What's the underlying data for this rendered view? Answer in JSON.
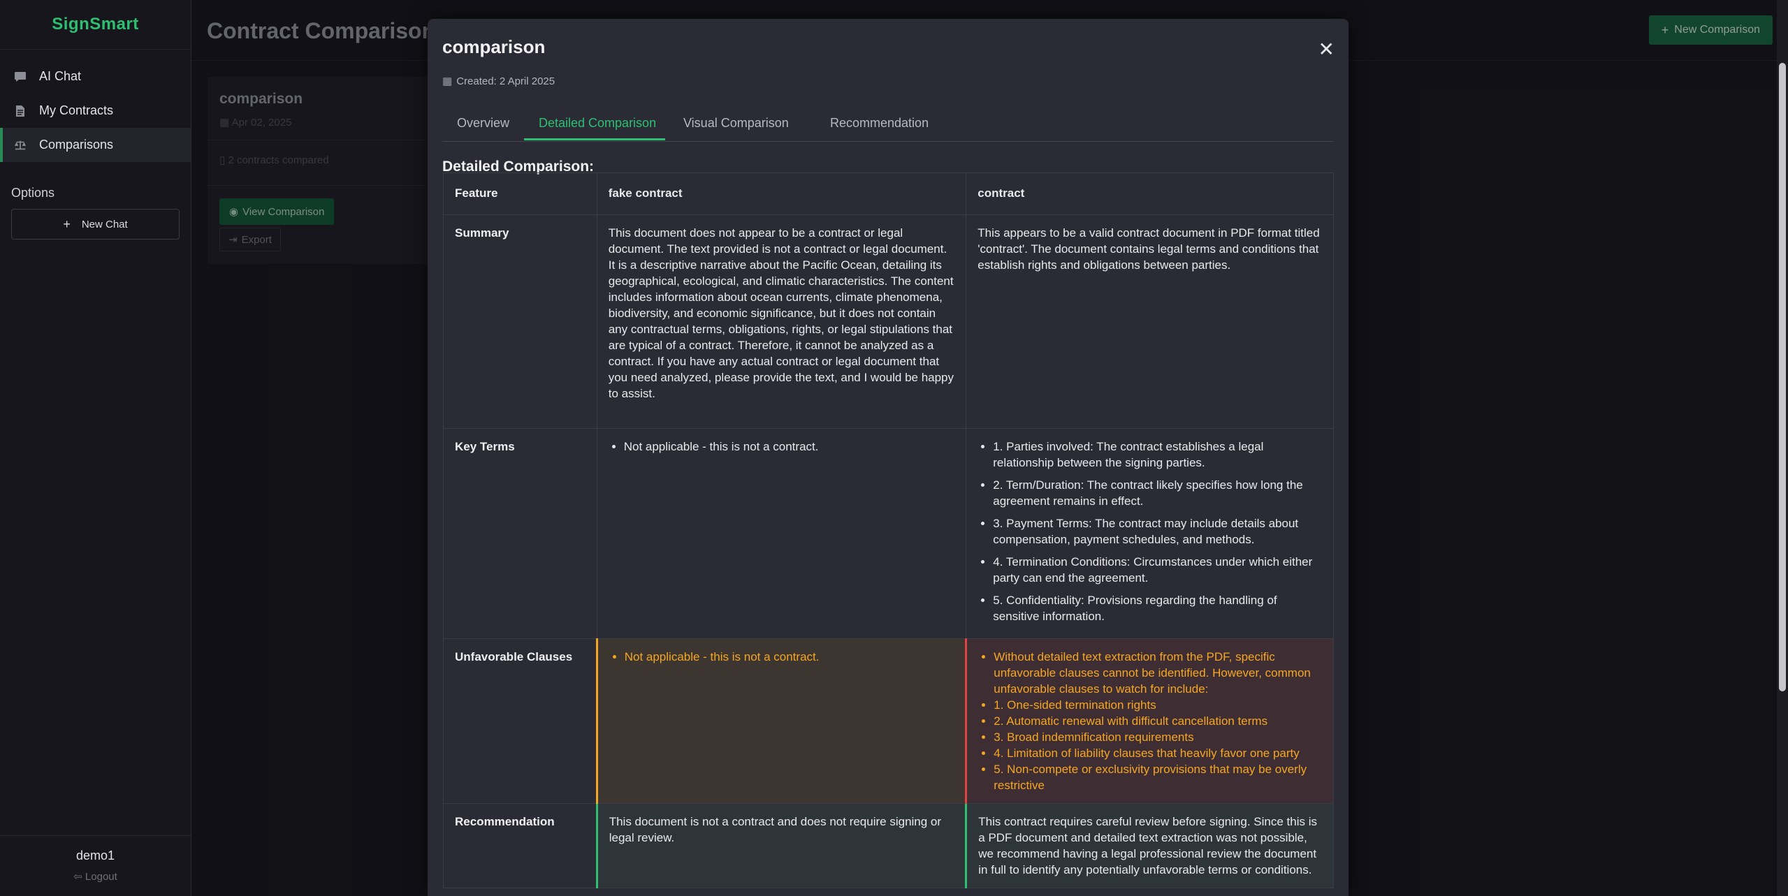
{
  "app": {
    "brand": "SignSmart"
  },
  "sidebar": {
    "items": [
      {
        "label": "AI Chat",
        "icon": "chat-icon"
      },
      {
        "label": "My Contracts",
        "icon": "document-icon"
      },
      {
        "label": "Comparisons",
        "icon": "scale-icon",
        "active": true
      }
    ],
    "options_label": "Options",
    "new_chat_label": "New Chat",
    "username": "demo1",
    "logout_label": "Logout"
  },
  "header": {
    "title": "Contract Comparison",
    "new_comparison_label": "New Comparison"
  },
  "card": {
    "title": "comparison",
    "date": "Apr 02, 2025",
    "meta": "2 contracts compared",
    "view_label": "View Comparison",
    "export_label": "Export"
  },
  "modal": {
    "title": "comparison",
    "created": "Created: 2 April 2025",
    "tabs": [
      "Overview",
      "Detailed Comparison",
      "Visual Comparison",
      "Recommendation"
    ],
    "active_tab": "Detailed Comparison",
    "section_title": "Detailed Comparison:",
    "table": {
      "headers": [
        "Feature",
        "fake contract",
        "contract"
      ],
      "summary": {
        "label": "Summary",
        "c1": "This document does not appear to be a contract or legal document. The text provided is not a contract or legal document. It is a descriptive narrative about the Pacific Ocean, detailing its geographical, ecological, and climatic characteristics. The content includes information about ocean currents, climate phenomena, biodiversity, and economic significance, but it does not contain any contractual terms, obligations, rights, or legal stipulations that are typical of a contract. Therefore, it cannot be analyzed as a contract. If you have any actual contract or legal document that you need analyzed, please provide the text, and I would be happy to assist.",
        "c2": "This appears to be a valid contract document in PDF format titled 'contract'. The document contains legal terms and conditions that establish rights and obligations between parties."
      },
      "key_terms": {
        "label": "Key Terms",
        "c1": [
          "Not applicable - this is not a contract."
        ],
        "c2": [
          "1. Parties involved: The contract establishes a legal relationship between the signing parties.",
          "2. Term/Duration: The contract likely specifies how long the agreement remains in effect.",
          "3. Payment Terms: The contract may include details about compensation, payment schedules, and methods.",
          "4. Termination Conditions: Circumstances under which either party can end the agreement.",
          "5. Confidentiality: Provisions regarding the handling of sensitive information."
        ]
      },
      "unfavorable": {
        "label": "Unfavorable Clauses",
        "c1": [
          "Not applicable - this is not a contract."
        ],
        "c2": [
          "Without detailed text extraction from the PDF, specific unfavorable clauses cannot be identified. However, common unfavorable clauses to watch for include:",
          "1. One-sided termination rights",
          "2. Automatic renewal with difficult cancellation terms",
          "3. Broad indemnification requirements",
          "4. Limitation of liability clauses that heavily favor one party",
          "5. Non-compete or exclusivity provisions that may be overly restrictive"
        ]
      },
      "recommendation": {
        "label": "Recommendation",
        "c1": "This document is not a contract and does not require signing or legal review.",
        "c2": "This contract requires careful review before signing. Since this is a PDF document and detailed text extraction was not possible, we recommend having a legal professional review the document in full to identify any potentially unfavorable terms or conditions."
      }
    }
  },
  "colors": {
    "accent": "#2fbf71",
    "warning": "#f5a623",
    "danger": "#e04545",
    "modal_bg": "#2b2b35"
  }
}
